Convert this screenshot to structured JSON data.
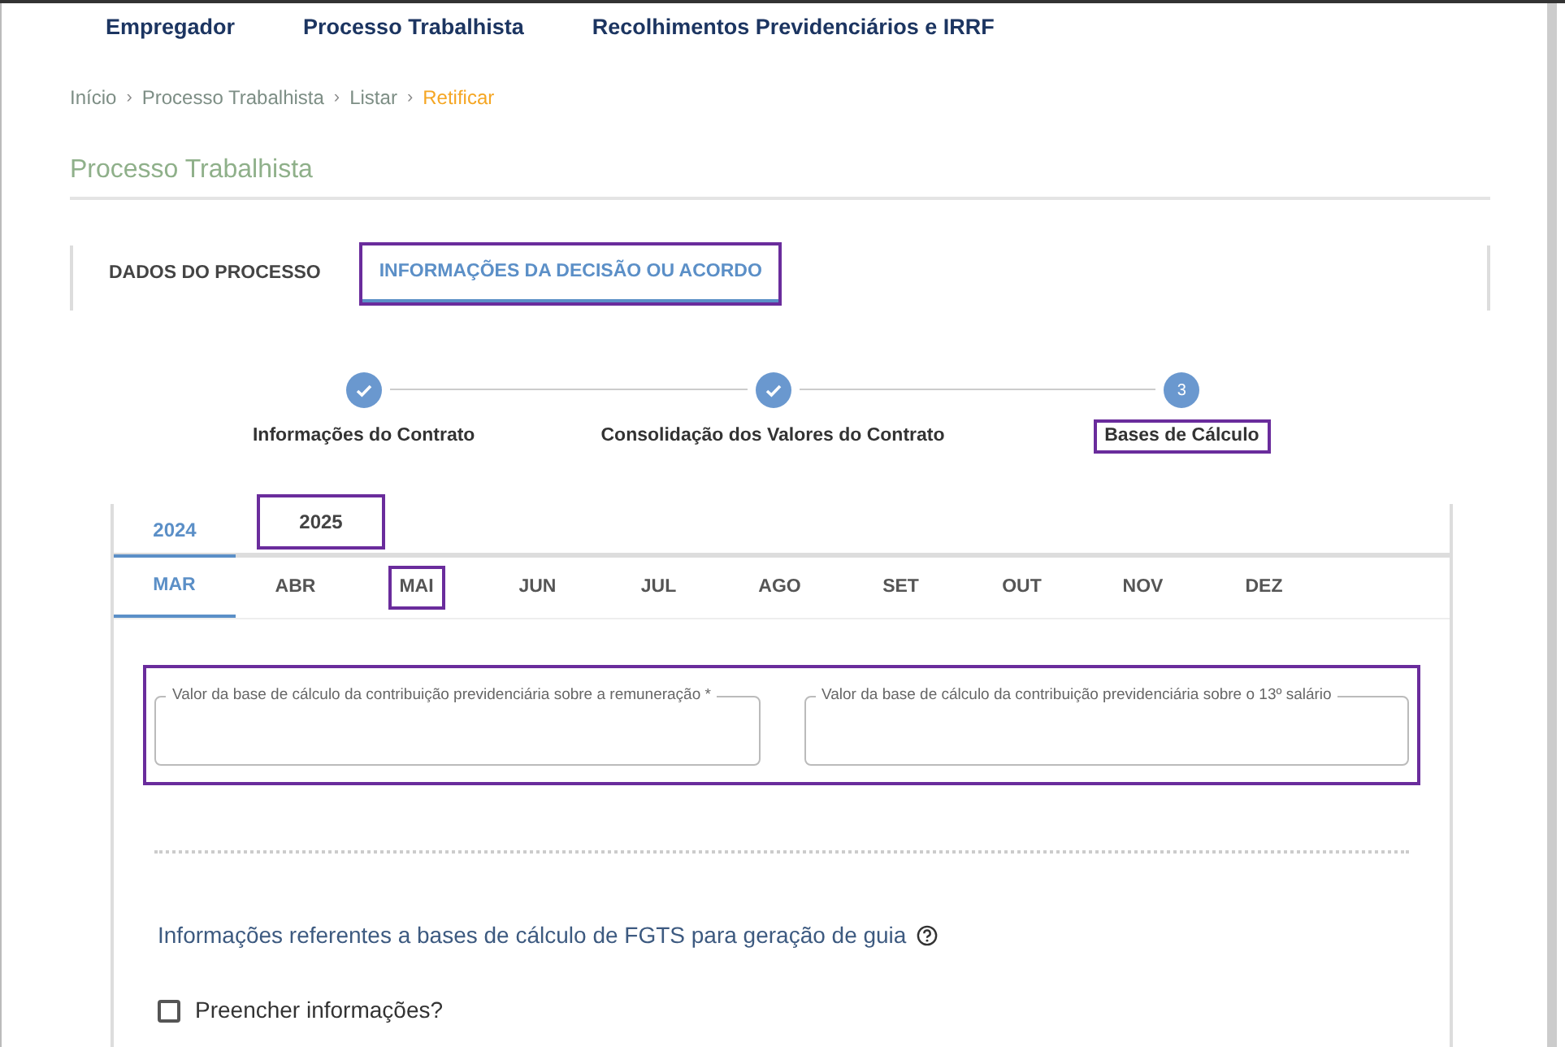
{
  "nav": [
    "Empregador",
    "Processo Trabalhista",
    "Recolhimentos Previdenciários e IRRF"
  ],
  "breadcrumb": [
    {
      "label": "Início",
      "current": false
    },
    {
      "label": "Processo Trabalhista",
      "current": false
    },
    {
      "label": "Listar",
      "current": false
    },
    {
      "label": "Retificar",
      "current": true
    }
  ],
  "breadcrumb_separator": "›",
  "page_title": "Processo Trabalhista",
  "tabs": [
    {
      "label": "DADOS DO PROCESSO",
      "selected": false,
      "highlighted": false
    },
    {
      "label": "INFORMAÇÕES DA DECISÃO OU ACORDO",
      "selected": true,
      "highlighted": true
    }
  ],
  "steps": [
    {
      "label": "Informações do Contrato",
      "done": true,
      "highlighted": false
    },
    {
      "label": "Consolidação dos Valores do Contrato",
      "done": true,
      "highlighted": false
    },
    {
      "label": "Bases de Cálculo",
      "done": false,
      "number": "3",
      "highlighted": true
    }
  ],
  "years": [
    {
      "label": "2024",
      "selected": true,
      "highlighted": false
    },
    {
      "label": "2025",
      "selected": false,
      "highlighted": true
    }
  ],
  "months": [
    {
      "label": "MAR",
      "selected": true,
      "highlighted": false
    },
    {
      "label": "ABR",
      "selected": false,
      "highlighted": false
    },
    {
      "label": "MAI",
      "selected": false,
      "highlighted": true
    },
    {
      "label": "JUN",
      "selected": false,
      "highlighted": false
    },
    {
      "label": "JUL",
      "selected": false,
      "highlighted": false
    },
    {
      "label": "AGO",
      "selected": false,
      "highlighted": false
    },
    {
      "label": "SET",
      "selected": false,
      "highlighted": false
    },
    {
      "label": "OUT",
      "selected": false,
      "highlighted": false
    },
    {
      "label": "NOV",
      "selected": false,
      "highlighted": false
    },
    {
      "label": "DEZ",
      "selected": false,
      "highlighted": false
    }
  ],
  "fields_highlighted": true,
  "fields": [
    {
      "label": "Valor da base de cálculo da contribuição previdenciária sobre a remuneração *"
    },
    {
      "label": "Valor da base de cálculo da contribuição previdenciária sobre o 13º salário"
    }
  ],
  "fgts_heading": "Informações referentes a bases de cálculo de FGTS para geração de guia",
  "fill_in": {
    "label": "Preencher informações?",
    "checked": false
  }
}
